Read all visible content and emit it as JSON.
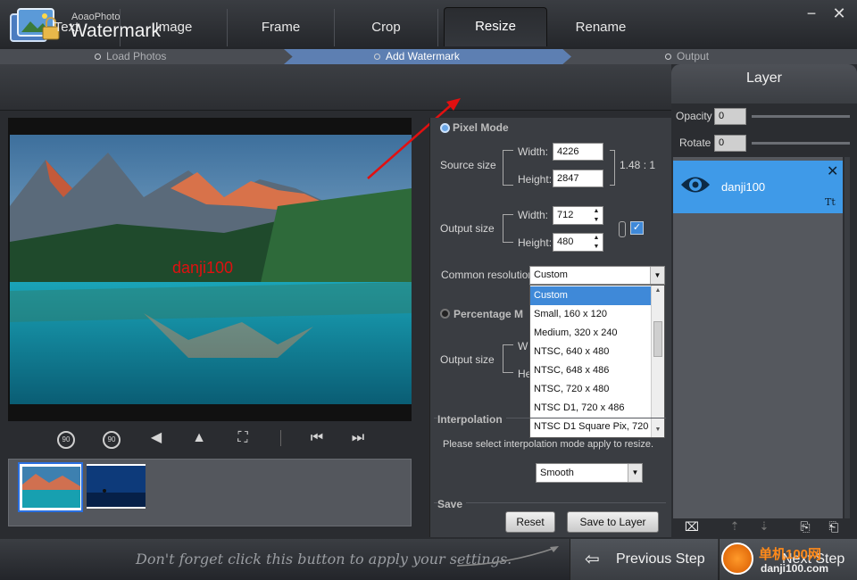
{
  "app": {
    "brand_small": "AoaoPhoto",
    "brand_big": "Watermark"
  },
  "window": {
    "minimize": "−",
    "close": "✕"
  },
  "steps": [
    {
      "label": "Load Photos",
      "active": false
    },
    {
      "label": "Add Watermark",
      "active": true
    },
    {
      "label": "Output",
      "active": false
    }
  ],
  "tabs": [
    {
      "label": "Text"
    },
    {
      "label": "Image"
    },
    {
      "label": "Frame"
    },
    {
      "label": "Crop"
    },
    {
      "label": "Resize",
      "active": true
    },
    {
      "label": "Rename"
    }
  ],
  "preview": {
    "watermark_text": "danji100"
  },
  "pixel_mode": {
    "title": "Pixel Mode",
    "source_label": "Source size",
    "source_width_label": "Width:",
    "source_width": "4226",
    "source_height_label": "Height:",
    "source_height": "2847",
    "ratio": "1.48 : 1",
    "output_label": "Output size",
    "output_width_label": "Width:",
    "output_width": "712",
    "output_height_label": "Height:",
    "output_height": "480",
    "common_label": "Common resolution",
    "common_value": "Custom"
  },
  "dropdown": {
    "options": [
      "Custom",
      "Small, 160 x 120",
      "Medium, 320 x 240",
      "NTSC, 640 x 480",
      "NTSC, 648 x 486",
      "NTSC, 720 x 480",
      "NTSC D1, 720 x 486",
      "NTSC D1 Square Pix, 720 x"
    ],
    "selected_index": 0
  },
  "percentage_mode": {
    "title": "Percentage M",
    "output_label": "Output size",
    "width_partial": "W",
    "height_partial": "He"
  },
  "interpolation": {
    "title": "Interpolation",
    "hint": "Please select interpolation mode apply to resize.",
    "value": "Smooth"
  },
  "save": {
    "title": "Save",
    "reset": "Reset",
    "save_to_layer": "Save to Layer"
  },
  "layer": {
    "title": "Layer",
    "opacity_label": "Opacity",
    "opacity_value": "0",
    "rotate_label": "Rotate",
    "rotate_value": "0",
    "item_name": "danji100",
    "item_type_glyph": "Tt"
  },
  "bottom": {
    "hint": "Don't forget click this button to apply your settings.",
    "previous": "Previous Step",
    "next": "Next Step",
    "watermark_site": "单机100网",
    "watermark_url": "danji100.com"
  },
  "colors": {
    "accent_blue": "#3f9ae8",
    "step_active": "#5d7fb2",
    "arrow_red": "#e21010"
  }
}
